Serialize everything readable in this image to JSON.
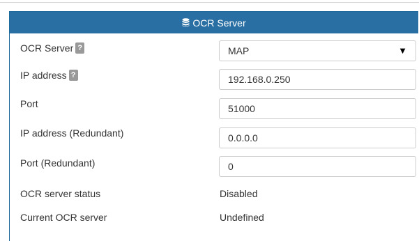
{
  "panel": {
    "title": "OCR Server",
    "title_icon": "database-icon",
    "header_color": "#2a6fa3"
  },
  "fields": {
    "ocr_server": {
      "label": "OCR Server",
      "value": "MAP"
    },
    "ip_address": {
      "label": "IP address",
      "value": "192.168.0.250"
    },
    "port": {
      "label": "Port",
      "value": "51000"
    },
    "ip_address_redundant": {
      "label": "IP address (Redundant)",
      "value": "0.0.0.0"
    },
    "port_redundant": {
      "label": "Port (Redundant)",
      "value": "0"
    },
    "ocr_server_status": {
      "label": "OCR server status",
      "value": "Disabled"
    },
    "current_ocr_server": {
      "label": "Current OCR server",
      "value": "Undefined"
    }
  },
  "help_icon_glyph": "?"
}
